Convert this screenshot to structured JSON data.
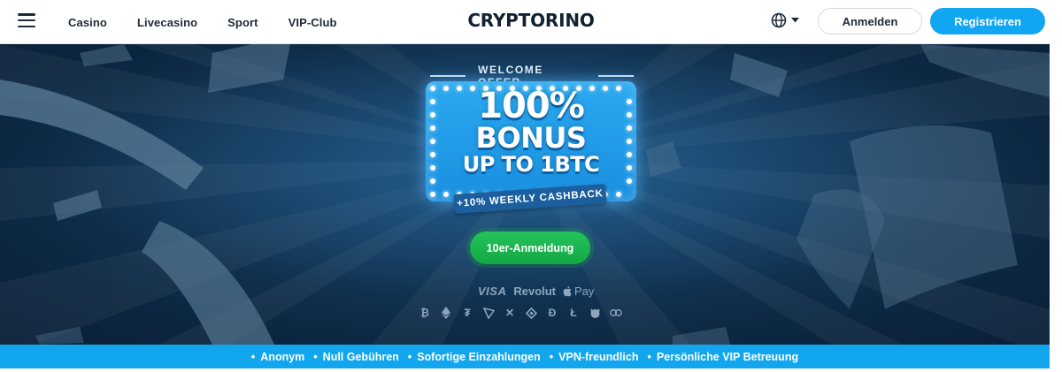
{
  "header": {
    "menu_icon": "hamburger-menu-icon",
    "nav": [
      "Casino",
      "Livecasino",
      "Sport",
      "VIP-Club"
    ],
    "logo": "CRYPTORINO",
    "language_icon": "globe-icon",
    "login_label": "Anmelden",
    "register_label": "Registrieren"
  },
  "hero": {
    "offer_label": "WELCOME OFFER",
    "bonus_line1": "100%",
    "bonus_line2": "BONUS",
    "bonus_line3": "UP TO 1BTC",
    "cashback": "+10% WEEKLY CASHBACK",
    "cta_label": "10er-Anmeldung",
    "payment_visa": "VISA",
    "payment_revolut": "Revolut",
    "payment_apple": "Pay",
    "crypto_icons": [
      "bitcoin-icon",
      "ethereum-icon",
      "tether-icon",
      "tron-icon",
      "ripple-icon",
      "binance-icon",
      "dogecoin-icon",
      "litecoin-icon",
      "shiba-icon",
      "chainlink-icon"
    ]
  },
  "features": [
    "Anonym",
    "Null Gebühren",
    "Sofortige Einzahlungen",
    "VPN-freundlich",
    "Persönliche VIP Betreuung"
  ],
  "colors": {
    "accent_blue": "#12a6ef",
    "cta_green": "#14a745",
    "hero_dark": "#0d2843",
    "text_dark": "#1d2a3a"
  }
}
